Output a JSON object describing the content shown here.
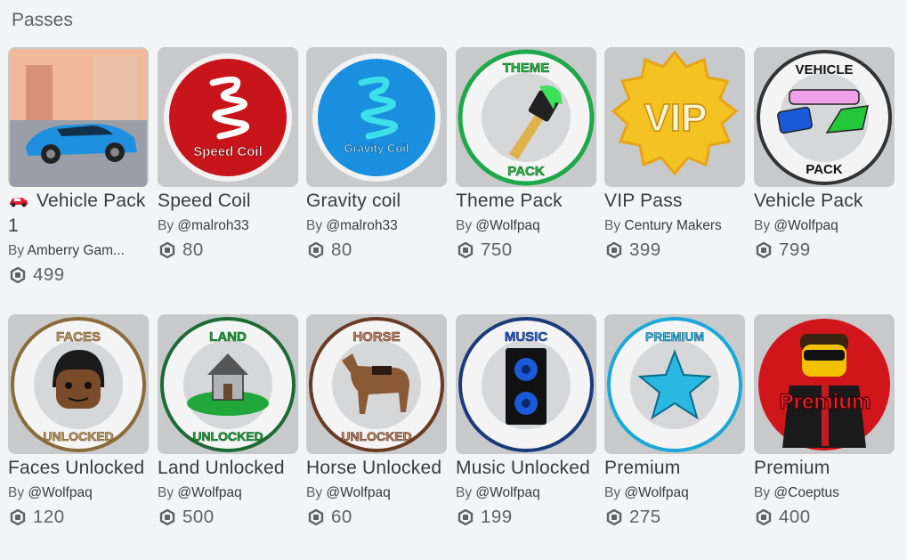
{
  "section": {
    "title": "Passes"
  },
  "colors": {
    "card_bg": "#c7c9cb",
    "page_bg": "#f2f4f5",
    "text": "#393b3d",
    "muted": "#606162"
  },
  "passes": [
    {
      "name": "Vehicle Pack 1",
      "by": "By",
      "creator": "Amberry Gam...",
      "price": "499",
      "icon": "supercar-thumbnail"
    },
    {
      "name": "Speed Coil",
      "by": "By",
      "creator": "@malroh33",
      "price": "80",
      "icon": "speed-coil-thumbnail",
      "badge": "Speed Coil"
    },
    {
      "name": "Gravity coil",
      "by": "By",
      "creator": "@malroh33",
      "price": "80",
      "icon": "gravity-coil-thumbnail",
      "badge": "Gravity Coil"
    },
    {
      "name": "Theme Pack",
      "by": "By",
      "creator": "@Wolfpaq",
      "price": "750",
      "icon": "paintbrush-thumbnail",
      "badge_top": "THEME",
      "badge_bottom": "PACK"
    },
    {
      "name": "VIP Pass",
      "by": "By",
      "creator": "Century Makers",
      "price": "399",
      "icon": "vip-badge-thumbnail",
      "badge": "VIP"
    },
    {
      "name": "Vehicle Pack",
      "by": "By",
      "creator": "@Wolfpaq",
      "price": "799",
      "icon": "vehicles-thumbnail",
      "badge_top": "VEHICLE",
      "badge_bottom": "PACK"
    },
    {
      "name": "Faces Unlocked",
      "by": "By",
      "creator": "@Wolfpaq",
      "price": "120",
      "icon": "face-thumbnail",
      "badge_top": "FACES",
      "badge_bottom": "UNLOCKED"
    },
    {
      "name": "Land Unlocked",
      "by": "By",
      "creator": "@Wolfpaq",
      "price": "500",
      "icon": "house-thumbnail",
      "badge_top": "LAND",
      "badge_bottom": "UNLOCKED"
    },
    {
      "name": "Horse Unlocked",
      "by": "By",
      "creator": "@Wolfpaq",
      "price": "60",
      "icon": "horse-thumbnail",
      "badge_top": "HORSE",
      "badge_bottom": "UNLOCKED"
    },
    {
      "name": "Music Unlocked",
      "by": "By",
      "creator": "@Wolfpaq",
      "price": "199",
      "icon": "speaker-thumbnail",
      "badge_top": "MUSIC",
      "badge_bottom": ""
    },
    {
      "name": "Premium",
      "by": "By",
      "creator": "@Wolfpaq",
      "price": "275",
      "icon": "star-thumbnail",
      "badge_top": "PREMIUM",
      "badge_bottom": ""
    },
    {
      "name": "Premium",
      "by": "By",
      "creator": "@Coeptus",
      "price": "400",
      "icon": "avatar-thumbnail",
      "badge": "Premium"
    }
  ]
}
